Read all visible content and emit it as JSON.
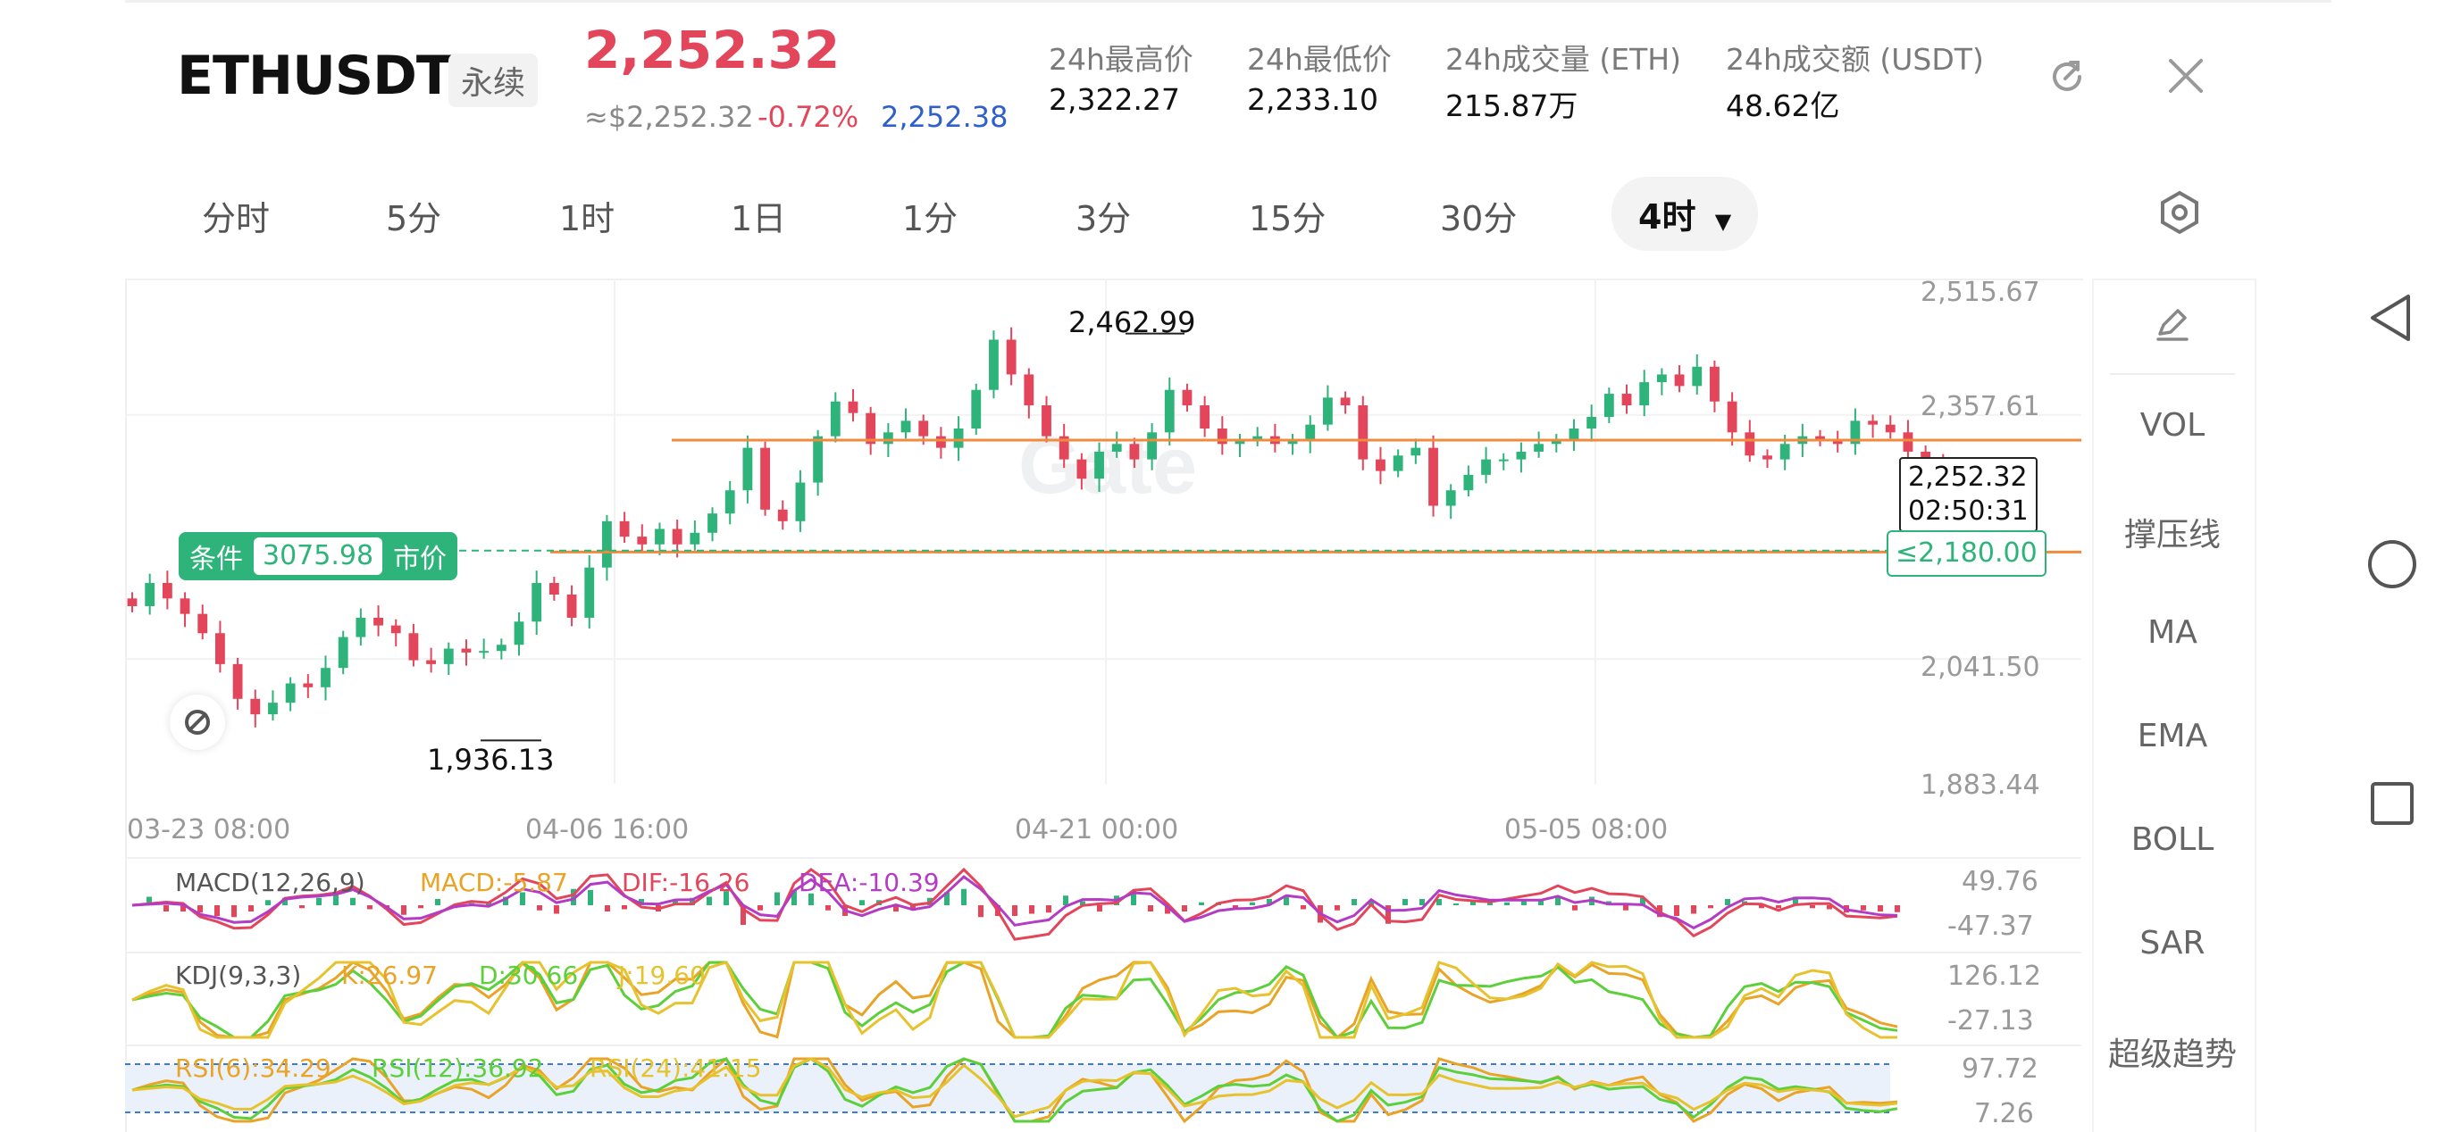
{
  "header": {
    "symbol": "ETHUSDT",
    "contract_type": "永续",
    "last_price": "2,252.32",
    "approx_usd": "≈$2,252.32",
    "change_pct": "-0.72%",
    "mark_price": "2,252.38",
    "stats": [
      {
        "label": "24h最高价",
        "value": "2,322.27"
      },
      {
        "label": "24h最低价",
        "value": "2,233.10"
      },
      {
        "label": "24h成交量 (ETH)",
        "value": "215.87万"
      },
      {
        "label": "24h成交额 (USDT)",
        "value": "48.62亿"
      }
    ],
    "colors": {
      "down": "#e3455a",
      "up": "#2eb47a",
      "mark": "#2f5fc9"
    }
  },
  "timeframes": {
    "items": [
      "分时",
      "5分",
      "1时",
      "1日",
      "1分",
      "3分",
      "15分",
      "30分"
    ],
    "active": "4时"
  },
  "chart": {
    "price_axis": [
      "2,515.67",
      "2,357.61",
      "2,041.50",
      "1,883.44"
    ],
    "time_axis": [
      "03-23 08:00",
      "04-06 16:00",
      "04-21 00:00",
      "05-05 08:00"
    ],
    "high_marker": "2,462.99",
    "low_marker": "1,936.13",
    "current_price": "2,252.32",
    "countdown": "02:50:31",
    "condition_order": {
      "label": "条件",
      "price": "3075.98",
      "type": "市价"
    },
    "trigger_label": "≤2,180.00"
  },
  "indicators": {
    "macd": {
      "label": "MACD(12,26,9)",
      "macd": "MACD:-5.87",
      "dif": "DIF:-16.26",
      "dea": "DEA:-10.39",
      "axis_top": "49.76",
      "axis_bottom": "-47.37"
    },
    "kdj": {
      "label": "KDJ(9,3,3)",
      "k": "K:26.97",
      "d": "D:30.66",
      "j": "J:19.60",
      "axis_top": "126.12",
      "axis_bottom": "-27.13"
    },
    "rsi": {
      "rsi6": "RSI(6):34.29",
      "rsi12": "RSI(12):36.92",
      "rsi24": "RSI(24):41.15",
      "axis_top": "97.72",
      "axis_bottom": "7.26"
    }
  },
  "side_panel": {
    "items": [
      "VOL",
      "撑压线",
      "MA",
      "EMA",
      "BOLL",
      "SAR",
      "超级趋势"
    ]
  },
  "chart_data": {
    "type": "candlestick",
    "title": "",
    "xlabel": "",
    "ylabel": "",
    "y_range": [
      1883.44,
      2515.67
    ],
    "x_ticks": [
      "03-23 08:00",
      "04-06 16:00",
      "04-21 00:00",
      "05-05 08:00"
    ],
    "y_ticks": [
      2515.67,
      2357.61,
      2041.5,
      1883.44
    ],
    "max_marker": 2462.99,
    "min_marker": 1936.13,
    "last": 2252.32,
    "horizontal_lines": [
      2325,
      2180
    ],
    "close_trend": [
      2110,
      2140,
      2120,
      2100,
      2075,
      2035,
      1990,
      1970,
      1985,
      2010,
      2005,
      2030,
      2070,
      2095,
      2085,
      2075,
      2040,
      2035,
      2055,
      2050,
      2052,
      2060,
      2090,
      2140,
      2125,
      2095,
      2160,
      2220,
      2200,
      2190,
      2210,
      2190,
      2205,
      2230,
      2260,
      2315,
      2235,
      2220,
      2270,
      2330,
      2375,
      2360,
      2320,
      2335,
      2350,
      2330,
      2315,
      2340,
      2390,
      2455,
      2410,
      2370,
      2330,
      2300,
      2275,
      2310,
      2320,
      2300,
      2335,
      2390,
      2370,
      2340,
      2320,
      2325,
      2330,
      2320,
      2325,
      2345,
      2380,
      2370,
      2300,
      2285,
      2305,
      2315,
      2240,
      2260,
      2280,
      2300,
      2300,
      2310,
      2320,
      2325,
      2340,
      2355,
      2385,
      2370,
      2400,
      2410,
      2395,
      2420,
      2375,
      2335,
      2305,
      2300,
      2320,
      2330,
      2325,
      2320,
      2350,
      2345,
      2335,
      2310,
      2295,
      2275,
      2252
    ]
  }
}
